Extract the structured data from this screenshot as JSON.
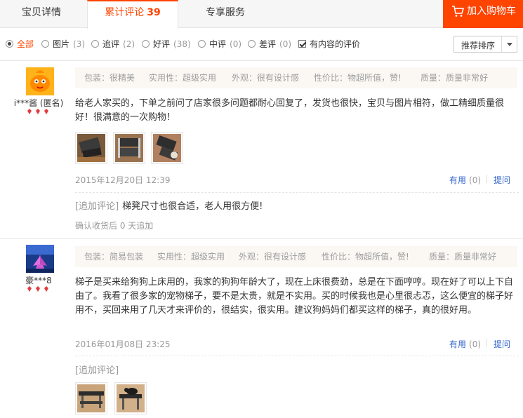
{
  "tabs": {
    "details": "宝贝详情",
    "reviews": "累计评论",
    "reviews_count": "39",
    "service": "专享服务",
    "cart": "加入购物车"
  },
  "filters": {
    "all": "全部",
    "pics": "图片",
    "pics_n": "(3)",
    "append": "追评",
    "append_n": "(2)",
    "good": "好评",
    "good_n": "(38)",
    "mid": "中评",
    "mid_n": "(0)",
    "bad": "差评",
    "bad_n": "(0)",
    "has_content": "有内容的评价",
    "sort": "推荐排序"
  },
  "reviews": [
    {
      "user": "i***酱 (匿名)",
      "tags": [
        "包装：很精美",
        "实用性：超级实用",
        "外观：很有设计感",
        "性价比：物超所值，赞!",
        "质量：质量非常好"
      ],
      "text": "给老人家买的，下单之前问了店家很多问题都耐心回复了，发货也很快，宝贝与图片相符，做工精细质量很好！很满意的一次购物！",
      "date": "2015年12月20日 12:39",
      "useful": "有用",
      "useful_n": "(0)",
      "ask": "提问",
      "append_label": "[追加评论]",
      "append_text": "梯凳尺寸也很合适，老人用很方便!",
      "confirm": "确认收货后 0 天追加"
    },
    {
      "user": "豪***8",
      "tags": [
        "包装：简易包装",
        "实用性：超级实用",
        "外观：很有设计感",
        "性价比：物超所值，赞!",
        "质量：质量非常好"
      ],
      "text": "梯子是买来给狗狗上床用的，我家的狗狗年龄大了，现在上床很费劲，总是在下面哼哼。现在好了可以上下自由了。我看了很多家的宠物梯子，要不是太贵，就是不实用。买的时候我也是心里很忐忑，这么便宜的梯子好用不，买回来用了几天才来评价的，很结实，很实用。建议狗妈妈们都买这样的梯子，真的很好用。",
      "date": "2016年01月08日 23:25",
      "useful": "有用",
      "useful_n": "(0)",
      "ask": "提问",
      "append_label": "[追加评论]"
    }
  ],
  "colors": {
    "accent": "#ff4400",
    "link": "#3366cc",
    "muted": "#999999"
  }
}
